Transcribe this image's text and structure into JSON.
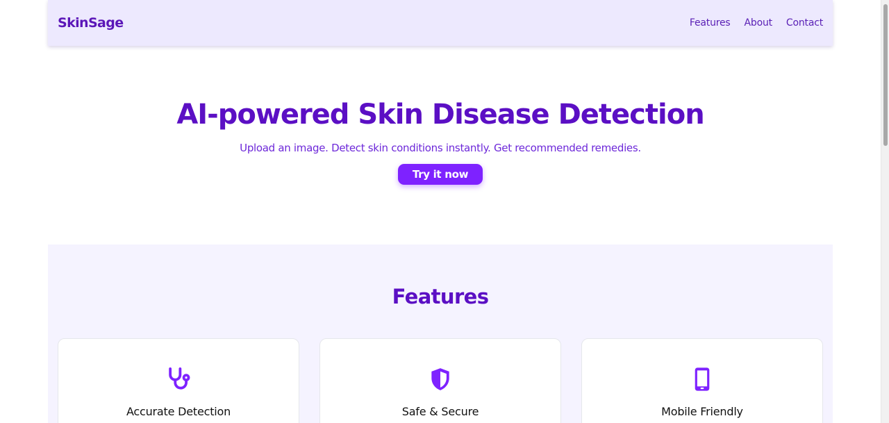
{
  "header": {
    "logo": "SkinSage",
    "nav": [
      "Features",
      "About",
      "Contact"
    ]
  },
  "hero": {
    "title": "AI-powered Skin Disease Detection",
    "subtitle": "Upload an image. Detect skin conditions instantly. Get recommended remedies.",
    "cta_label": "Try it now"
  },
  "features": {
    "heading": "Features",
    "cards": [
      {
        "icon": "stethoscope-icon",
        "title": "Accurate Detection"
      },
      {
        "icon": "shield-icon",
        "title": "Safe & Secure"
      },
      {
        "icon": "smartphone-icon",
        "title": "Mobile Friendly"
      }
    ]
  },
  "colors": {
    "brand": "#5b0fc4",
    "accent": "#7e22ff",
    "header_bg": "#ede9fe",
    "features_bg": "#f5f3ff"
  }
}
